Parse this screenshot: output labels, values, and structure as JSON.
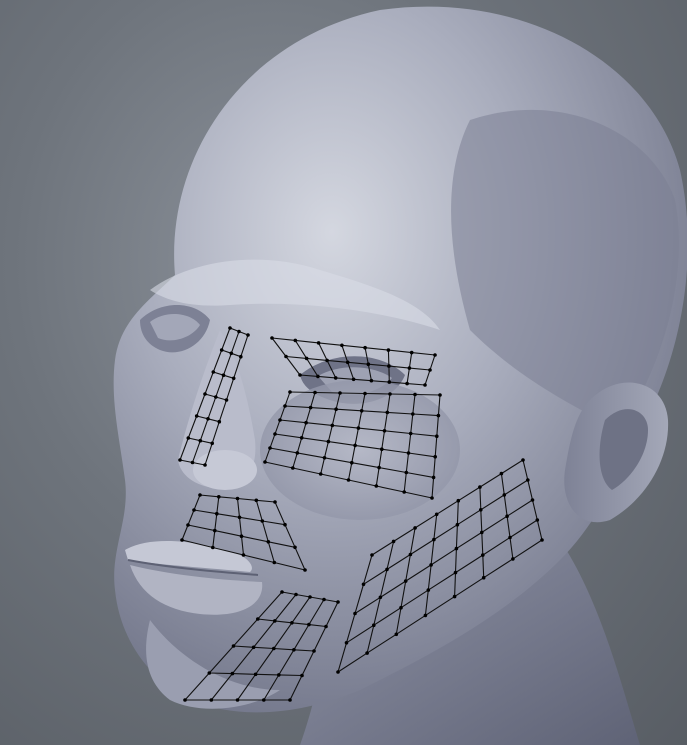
{
  "colors": {
    "background_light": "#8a9099",
    "background_dark": "#585d64",
    "mesh_skin_light": "#c9ccd6",
    "mesh_skin_mid": "#9fa3b4",
    "mesh_skin_dark": "#6c7084",
    "wire": "#111111"
  },
  "scene": {
    "subject": "sculpted-head-mesh",
    "overlay": "retopology-wireframe-patches"
  }
}
